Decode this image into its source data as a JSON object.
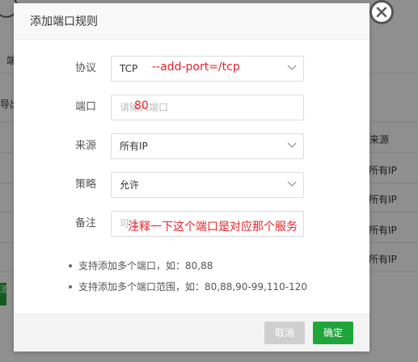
{
  "background": {
    "label_top": "端",
    "label_export": "导出",
    "column_source": "来源",
    "rows": [
      "所有IP",
      "所有IP",
      "所有IP",
      "所有IP"
    ],
    "green_button_label": "添"
  },
  "dialog": {
    "title": "添加端口规则",
    "fields": {
      "protocol": {
        "label": "协议",
        "value": "TCP"
      },
      "port": {
        "label": "端口",
        "placeholder": "请输入端口"
      },
      "source": {
        "label": "来源",
        "value": "所有IP"
      },
      "policy": {
        "label": "策略",
        "value": "允许"
      },
      "remark": {
        "label": "备注",
        "placeholder": "可选"
      }
    },
    "tips": [
      "支持添加多个端口，如：80,88",
      "支持添加多个端口范围，如：80,88,90-99,110-120"
    ],
    "buttons": {
      "cancel": "取消",
      "confirm": "确定"
    }
  },
  "annotations": {
    "protocol_note": "--add-port=/tcp",
    "port_note": "80",
    "remark_note": "注释一下这个端口是对应那个服务"
  },
  "colors": {
    "accent_green": "#20a53a",
    "annotation_red": "#e8242a"
  }
}
